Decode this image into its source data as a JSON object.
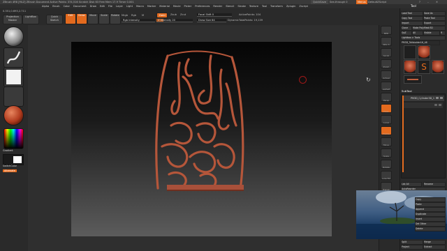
{
  "titlebar": {
    "title": "ZBrush 4R8 [MLZ] ZBrush Document  Active Points: 374,516  Scratch Disk 63  Free Mem 17.9  Timer 0.001",
    "quicksave": "QuickSave",
    "seethrough": "See-through 0",
    "menus_btn": "Menus",
    "script": "DefaultZScript"
  },
  "menubar": {
    "items": [
      "Alpha",
      "Brush",
      "Color",
      "Document",
      "Draw",
      "Edit",
      "File",
      "Layer",
      "Light",
      "Macro",
      "Marker",
      "Material",
      "Movie",
      "Picker",
      "Preferences",
      "Render",
      "Stencil",
      "Stroke",
      "Texture",
      "Tool",
      "Transform",
      "Zplugin",
      "Zscript"
    ]
  },
  "coords": "0.351,0.693,2.711",
  "topbar": {
    "projection_master": "Projection Master",
    "lightbox": "LightBox",
    "quick_sketch": "Quick Sketch",
    "edit": "Edit",
    "draw": "Draw",
    "move": "Move",
    "scale": "Scale",
    "rotate": "Rotate",
    "mrgb": "Mrgb",
    "rgb": "Rgb",
    "m": "M",
    "rgb_intensity": "Rgb Intensity",
    "zadd": "Zadd",
    "zsub": "Zsub",
    "zcut": "Zcut",
    "z_intensity": "Z Intensity 20",
    "z_intensity_value": 20,
    "focal_shift": "Focal Shift 0",
    "draw_size": "Draw Size 64",
    "dynamic": "Dynamic",
    "active_points": "ActivePoints: 104",
    "total_points": "TotalPoints: 19,139"
  },
  "lefttray": {
    "gradient": "Gradient",
    "switchcolor": "SwitchColor",
    "alternate": "Alternate"
  },
  "righttray": {
    "icons": [
      "BPR",
      "SPix 3",
      "Scroll",
      "Zoom",
      "Actual",
      "AAHalf",
      "Persp",
      "Floor",
      "Local",
      "Frame",
      "Move",
      "Scale",
      "Rotate",
      "Line Fill",
      "Transp",
      "Solo"
    ]
  },
  "panel": {
    "tool_title": "Tool",
    "load_tool": "Load Tool",
    "save_as": "Save As",
    "copy_tool": "Copy Tool",
    "paste_tool": "Paste Tool",
    "import": "Import",
    "export": "Export",
    "clone": "Clone",
    "make_polymesh": "Make PolyMesh3D",
    "goz": "GoZ",
    "all": "All",
    "visible": "Visible",
    "r": "R",
    "lightbox_tools": "Lightbox > Tools",
    "current_tool": "PM3D_Tallstolder16_48",
    "tool_thumbs": [
      "PM3D_Tallst",
      "Cylinder3D",
      "PolyMesh3D",
      "SimpleBrush",
      "PM3D_Tallst"
    ],
    "subtool": "SubTool",
    "subtool_items": [
      "PM3D_Cylinder3D_1"
    ],
    "list_all": "List All",
    "rename": "Rename",
    "autoreorder": "AutoReorder",
    "all_low": "All Low",
    "all_high": "All High",
    "copy": "Copy",
    "paste": "Paste",
    "append": "Append",
    "duplicate": "Duplicate",
    "insert": "Insert",
    "del_other": "Del Other",
    "delete": "Delete",
    "split": "Split",
    "merge": "Merge",
    "remesh": "Remesh",
    "project": "Project",
    "extract": "Extract"
  }
}
